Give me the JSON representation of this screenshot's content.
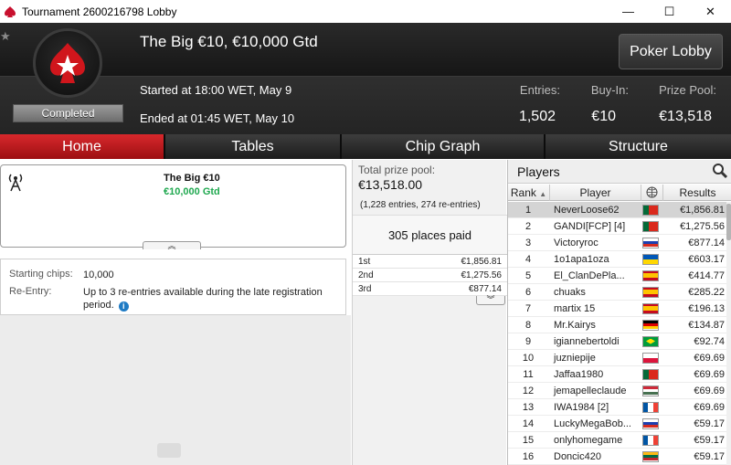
{
  "window": {
    "title": "Tournament 2600216798 Lobby",
    "minimize": "—",
    "maximize": "☐",
    "close": "✕"
  },
  "header": {
    "tournament_name": "The Big €10, €10,000 Gtd",
    "status": "Completed",
    "started": "Started at 18:00 WET, May 9",
    "ended": "Ended at 01:45 WET, May 10",
    "entries_label": "Entries:",
    "entries_value": "1,502",
    "buyin_label": "Buy-In:",
    "buyin_value": "€10",
    "prizepool_label": "Prize Pool:",
    "prizepool_value": "€13,518",
    "poker_lobby_label": "Poker Lobby",
    "favorite_icon": "★"
  },
  "tabs": [
    {
      "label": "Home"
    },
    {
      "label": "Tables"
    },
    {
      "label": "Chip Graph"
    },
    {
      "label": "Structure"
    }
  ],
  "card": {
    "title": "The Big €10",
    "guarantee": "€10,000 Gtd",
    "expand_glyph": "︽"
  },
  "info": {
    "starting_chips_label": "Starting chips:",
    "starting_chips_value": "10,000",
    "reentry_label": "Re-Entry:",
    "reentry_value": "Up to 3 re-entries available during the late registration period.",
    "info_icon": "i"
  },
  "prize": {
    "total_label": "Total prize pool:",
    "total_value": "€13,518.00",
    "entries_text": "(1,228 entries, 274 re-entries)",
    "places_paid": "305 places paid",
    "payouts": [
      {
        "place": "1st",
        "amount": "€1,856.81"
      },
      {
        "place": "2nd",
        "amount": "€1,275.56"
      },
      {
        "place": "3rd",
        "amount": "€877.14"
      }
    ],
    "expand_glyph": "︾"
  },
  "players": {
    "title": "Players",
    "col_rank": "Rank",
    "col_player": "Player",
    "col_results": "Results",
    "sort_glyph": "▲",
    "rows": [
      {
        "rank": "1",
        "name": "NeverLoose62",
        "flag": "pt",
        "result": "€1,856.81"
      },
      {
        "rank": "2",
        "name": "GANDI[FCP] [4]",
        "flag": "pt",
        "result": "€1,275.56"
      },
      {
        "rank": "3",
        "name": "Victoryroc",
        "flag": "ru",
        "result": "€877.14"
      },
      {
        "rank": "4",
        "name": "1o1apa1oza",
        "flag": "ua",
        "result": "€603.17"
      },
      {
        "rank": "5",
        "name": "El_ClanDePla...",
        "flag": "es",
        "result": "€414.77"
      },
      {
        "rank": "6",
        "name": "chuaks",
        "flag": "es",
        "result": "€285.22"
      },
      {
        "rank": "7",
        "name": "martix 15",
        "flag": "es",
        "result": "€196.13"
      },
      {
        "rank": "8",
        "name": "Mr.Kairys",
        "flag": "de",
        "result": "€134.87"
      },
      {
        "rank": "9",
        "name": "igiannebertoldi",
        "flag": "br",
        "result": "€92.74"
      },
      {
        "rank": "10",
        "name": "juzniepije",
        "flag": "pl",
        "result": "€69.69"
      },
      {
        "rank": "11",
        "name": "Jaffaa1980",
        "flag": "pt",
        "result": "€69.69"
      },
      {
        "rank": "12",
        "name": "jemapelleclaude",
        "flag": "hu",
        "result": "€69.69"
      },
      {
        "rank": "13",
        "name": "IWA1984 [2]",
        "flag": "fr",
        "result": "€69.69"
      },
      {
        "rank": "14",
        "name": "LuckyMegaBob...",
        "flag": "ru",
        "result": "€59.17"
      },
      {
        "rank": "15",
        "name": "onlyhomegame",
        "flag": "fr",
        "result": "€59.17"
      },
      {
        "rank": "16",
        "name": "Doncic420",
        "flag": "lt",
        "result": "€59.17"
      }
    ]
  },
  "colors": {
    "active_tab": "#c41e22",
    "guarantee_green": "#1fa84f",
    "header_bg": "#1c1c1c"
  }
}
